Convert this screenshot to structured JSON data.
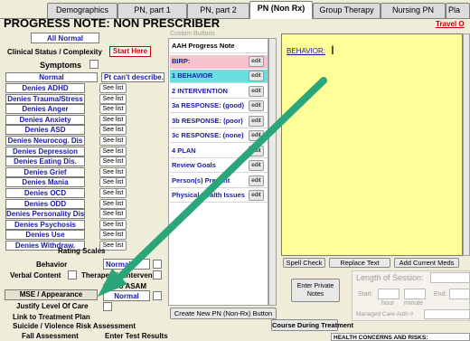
{
  "tabs": [
    {
      "label": "Demographics"
    },
    {
      "label": "PN, part 1"
    },
    {
      "label": "PN, part 2"
    },
    {
      "label": "PN (Non Rx)"
    },
    {
      "label": "Group Therapy"
    },
    {
      "label": "Nursing PN"
    },
    {
      "label": "Pla"
    }
  ],
  "travel_label": "Travel O",
  "page_title": "PROGRESS NOTE: NON PRESCRIBER",
  "left": {
    "all_normal": "All Normal",
    "clinical_status": "Clinical Status / Complexity",
    "start_here": "Start Here",
    "symptoms": "Symptoms",
    "normal": "Normal",
    "cant_describe": "Pt can't describe...",
    "see_list": "See list",
    "symptom_rows": [
      "Denies ADHD",
      "Denies Trauma/Stress",
      "Denies Anger",
      "Denies Anxiety",
      "Denies ASD",
      "Denies Neurocog. Dis",
      "Denies Depression",
      "Denies Eating Dis.",
      "Denies Grief",
      "Denies Mania",
      "Denies OCD",
      "Denies ODD",
      "Denies Personality Dis.",
      "Denies Psychosis",
      "Denies Use",
      "Denies Withdraw."
    ],
    "rating_scales": "Rating Scales",
    "behavior": "Behavior",
    "normal2": "Normal",
    "verbal_content": "Verbal Content",
    "therapeutic_intervent": "Therapeutic Intervent.",
    "go_to_asam": "Go To ASAM",
    "mse": "MSE / Appearance",
    "normal3": "Normal",
    "justify_loc": "Justify Level Of Care",
    "link_tx_plan": "Link to Treatment Plan",
    "suicide": "Suicide / Violence Risk Assessment",
    "fall_assessment": "Fall Assessment",
    "enter_test_results": "Enter Test Results"
  },
  "middle": {
    "custom_buttons": "Custom Buttons",
    "edit": "edit",
    "items": [
      "AAH Progress Note",
      "BIRP:",
      "1 BEHAVIOR",
      "2 INTERVENTION",
      "3a RESPONSE: (good)",
      "3b RESPONSE: (poor)",
      "3c RESPONSE: (none)",
      "4 PLAN",
      "Review Goals",
      "Person(s) Present",
      "Physical Health Issues"
    ],
    "create_new": "Create New PN (Non-Rx) Button"
  },
  "right": {
    "note_text": "BEHAVIOR:",
    "spell_check": "Spell Check",
    "replace_text": "Replace Text",
    "add_current_meds": "Add Current Meds",
    "enter_private_notes": "Enter Private Notes",
    "length_of_session": "Length of Session:",
    "start": "Start:",
    "hour": "hour",
    "minute": "minute",
    "end": "End:",
    "managed_care": "Managed Care Auth #",
    "course_during_treatment": "Course During Treatment",
    "bottom_text": "HEALTH CONCERNS AND RISKS:"
  },
  "colors": {
    "background": "#f0ecda",
    "editor": "#ffff99",
    "arrow": "#2aa67a",
    "link_blue": "#1a1aa8",
    "birp": "#f6c2cc",
    "behavior_item": "#66e0e0"
  }
}
